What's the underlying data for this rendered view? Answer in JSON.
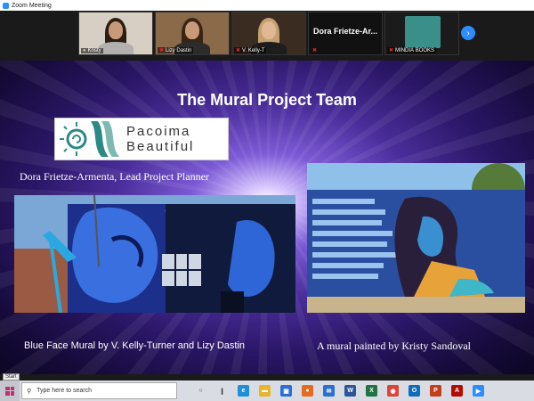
{
  "window": {
    "title": "Zoom Meeting"
  },
  "gallery": {
    "participants": [
      {
        "name": "Kristy",
        "muted": false
      },
      {
        "name": "Lizy Dastin",
        "muted": true
      },
      {
        "name": "V. Kelly-T",
        "muted": true
      },
      {
        "name": "Dora  Frietze-Ar...",
        "muted": true,
        "video": false
      },
      {
        "name": "MINDIA BOOKS",
        "muted": true
      }
    ],
    "next_icon": "chevron-right-icon"
  },
  "slide": {
    "title": "The Mural Project Team",
    "logo_text_line1": "Pacoima",
    "logo_text_line2": "Beautiful",
    "lead_caption": "Dora Frietze-Armenta, Lead Project Planner",
    "left_caption": "Blue Face Mural by V. Kelly-Turner and Lizy Dastin",
    "right_caption": "A mural painted by Kristy Sandoval",
    "left_photo_icon": "blue-face-mural-photo",
    "right_photo_icon": "woman-mural-photo"
  },
  "tooltip": {
    "text": "Start"
  },
  "taskbar": {
    "search_placeholder": "Type here to search",
    "icons": [
      {
        "name": "task-view-icon",
        "color": "#333333",
        "glyph": "○"
      },
      {
        "name": "widgets-icon",
        "color": "#333333",
        "glyph": "❙"
      },
      {
        "name": "edge-icon",
        "color": "#1f8fd6",
        "glyph": "e"
      },
      {
        "name": "file-explorer-icon",
        "color": "#e8b430",
        "glyph": "▬"
      },
      {
        "name": "store-icon",
        "color": "#2a6fd1",
        "glyph": "▣"
      },
      {
        "name": "firefox-icon",
        "color": "#e66a1f",
        "glyph": "●"
      },
      {
        "name": "mail-icon",
        "color": "#2a6fd1",
        "glyph": "✉"
      },
      {
        "name": "word-icon",
        "color": "#2b579a",
        "glyph": "W"
      },
      {
        "name": "excel-icon",
        "color": "#217346",
        "glyph": "X"
      },
      {
        "name": "chrome-icon",
        "color": "#d9453a",
        "glyph": "◉"
      },
      {
        "name": "outlook-icon",
        "color": "#0f6cbd",
        "glyph": "O"
      },
      {
        "name": "powerpoint-icon",
        "color": "#c43e1c",
        "glyph": "P"
      },
      {
        "name": "acrobat-icon",
        "color": "#b30b00",
        "glyph": "A"
      },
      {
        "name": "zoom-icon",
        "color": "#2d8cff",
        "glyph": "▶"
      }
    ]
  }
}
